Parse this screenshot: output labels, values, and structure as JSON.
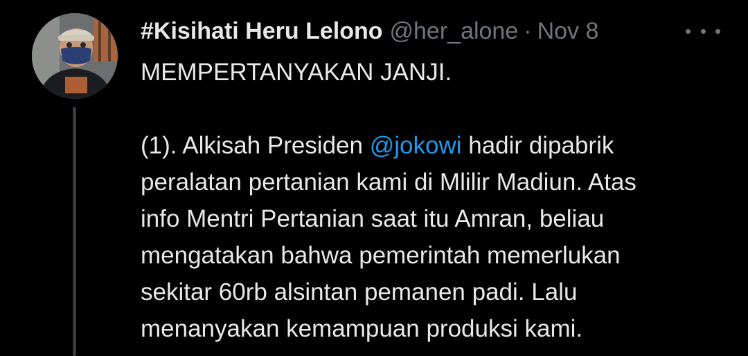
{
  "tweet": {
    "display_name": "#Kisihati Heru Lelono",
    "handle": "@her_alone",
    "separator": "·",
    "date": "Nov 8",
    "text": {
      "line1": "MEMPERTANYAKAN JANJI.",
      "line3_pre": "(1). Alkisah Presiden ",
      "mention": "@jokowi",
      "line3_post": " hadir dipabrik",
      "line4": "peralatan pertanian kami di Mlilir Madiun. Atas",
      "line5": "info Mentri Pertanian saat itu Amran, beliau",
      "line6": "mengatakan bahwa pemerintah memerlukan",
      "line7": "sekitar 60rb alsintan pemanen padi. Lalu",
      "line8": "menanyakan kemampuan produksi kami."
    }
  },
  "icons": {
    "more": "more-horizontal-icon",
    "avatar": "avatar"
  },
  "colors": {
    "background": "#000000",
    "primary_text": "#e7e9ea",
    "secondary_text": "#71767b",
    "mention": "#1d9bf0",
    "thread_line": "#3a3d40"
  }
}
